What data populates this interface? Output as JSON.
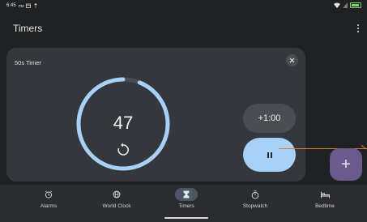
{
  "status_bar": {
    "time": "6:45",
    "ampm": "PM"
  },
  "app": {
    "title": "Timers"
  },
  "timer": {
    "label": "50s Timer",
    "remaining": "47",
    "progress": 0.94,
    "add_time_label": "+1:00"
  },
  "nav": {
    "items": [
      {
        "label": "Alarms",
        "icon": "alarm-icon"
      },
      {
        "label": "World Clock",
        "icon": "globe-icon"
      },
      {
        "label": "Timers",
        "icon": "hourglass-icon",
        "active": true
      },
      {
        "label": "Stopwatch",
        "icon": "stopwatch-icon"
      },
      {
        "label": "Bedtime",
        "icon": "bed-icon"
      }
    ]
  },
  "colors": {
    "background": "#1f2123",
    "card": "#34373b",
    "accent_blue": "#a8d1f7",
    "fab": "#6a5a8e",
    "pointer": "#e07b30"
  }
}
